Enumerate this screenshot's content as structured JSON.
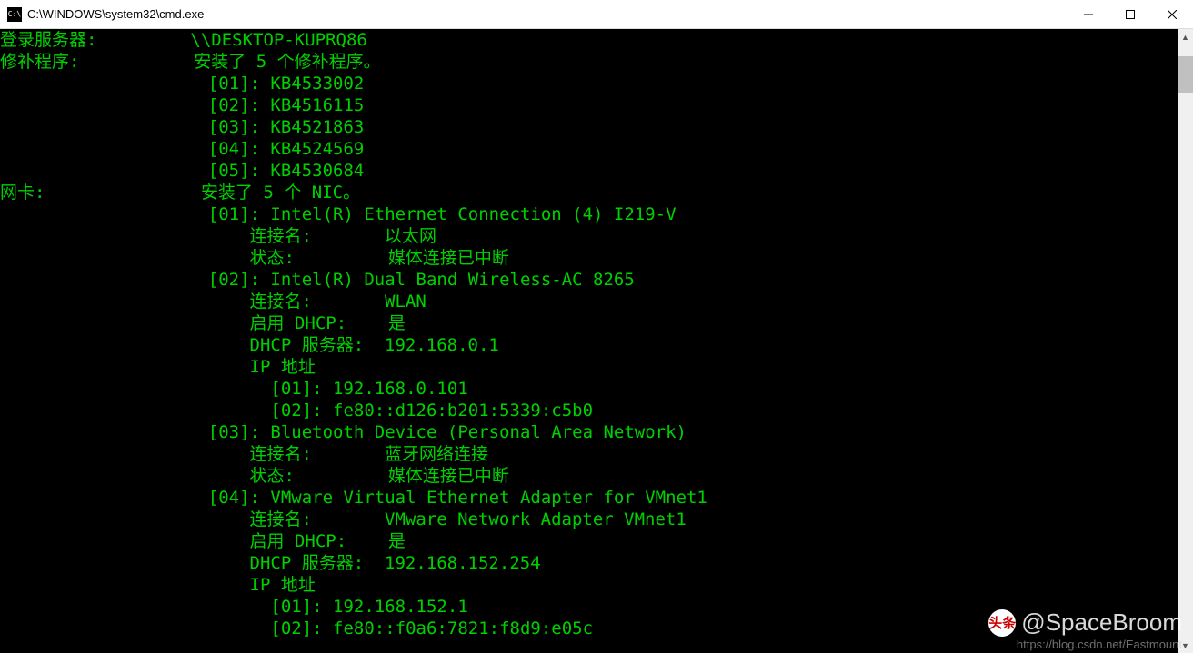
{
  "window": {
    "title": "C:\\WINDOWS\\system32\\cmd.exe",
    "icon_label": "C:\\"
  },
  "terminal_lines": [
    "登录服务器:         \\\\DESKTOP-KUPRQ86",
    "修补程序:           安装了 5 个修补程序。",
    "                    [01]: KB4533002",
    "                    [02]: KB4516115",
    "                    [03]: KB4521863",
    "                    [04]: KB4524569",
    "                    [05]: KB4530684",
    "网卡:               安装了 5 个 NIC。",
    "                    [01]: Intel(R) Ethernet Connection (4) I219-V",
    "                        连接名:       以太网",
    "                        状态:         媒体连接已中断",
    "                    [02]: Intel(R) Dual Band Wireless-AC 8265",
    "                        连接名:       WLAN",
    "                        启用 DHCP:    是",
    "                        DHCP 服务器:  192.168.0.1",
    "                        IP 地址",
    "                          [01]: 192.168.0.101",
    "                          [02]: fe80::d126:b201:5339:c5b0",
    "                    [03]: Bluetooth Device (Personal Area Network)",
    "                        连接名:       蓝牙网络连接",
    "                        状态:         媒体连接已中断",
    "                    [04]: VMware Virtual Ethernet Adapter for VMnet1",
    "                        连接名:       VMware Network Adapter VMnet1",
    "                        启用 DHCP:    是",
    "                        DHCP 服务器:  192.168.152.254",
    "                        IP 地址",
    "                          [01]: 192.168.152.1",
    "                          [02]: fe80::f0a6:7821:f8d9:e05c"
  ],
  "watermark": {
    "badge": "头条",
    "handle": "@SpaceBroom",
    "url": "https://blog.csdn.net/Eastmount"
  }
}
